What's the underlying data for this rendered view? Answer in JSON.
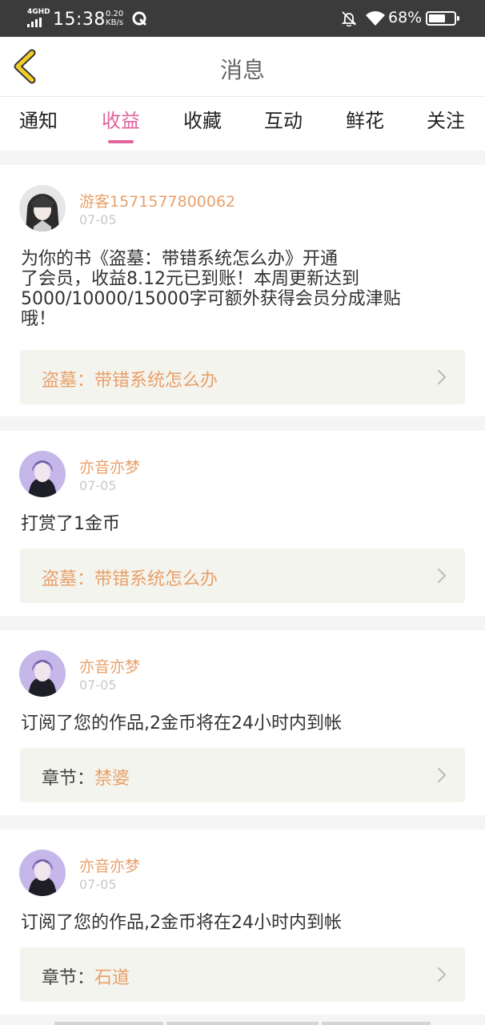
{
  "status_bar": {
    "network": "4GHD",
    "time": "15:38",
    "speed_value": "0.20",
    "speed_unit": "KB/s",
    "battery_percent": "68%",
    "battery_level": 0.68,
    "icons": [
      "signal-icon",
      "app-q-icon",
      "bell-off-icon",
      "wifi-icon",
      "battery-icon"
    ]
  },
  "header": {
    "title": "消息",
    "back_icon": "chevron-left-icon",
    "accent_color": "#e8c020"
  },
  "tabs": [
    {
      "label": "通知",
      "active": false
    },
    {
      "label": "收益",
      "active": true
    },
    {
      "label": "收藏",
      "active": false
    },
    {
      "label": "互动",
      "active": false
    },
    {
      "label": "鲜花",
      "active": false
    },
    {
      "label": "关注",
      "active": false
    }
  ],
  "colors": {
    "tab_active": "#e0659d",
    "username": "#e8a06a",
    "link_text": "#e8a06a",
    "link_bg": "#f4f4ee"
  },
  "messages": [
    {
      "username": "游客1571577800062",
      "date": "07-05",
      "text_lines": [
        "为你的书《盗墓：带错系统怎么办》开通",
        "了会员，收益8.12元已到账！本周更新达到",
        "5000/10000/15000字可额外获得会员分成津贴",
        "哦！"
      ],
      "link_label": "",
      "link_text": "盗墓：带错系统怎么办"
    },
    {
      "username": "亦音亦梦",
      "date": "07-05",
      "text_lines": [
        "打赏了1金币"
      ],
      "link_label": "",
      "link_text": "盗墓：带错系统怎么办"
    },
    {
      "username": "亦音亦梦",
      "date": "07-05",
      "text_lines": [
        "订阅了您的作品,2金币将在24小时内到帐"
      ],
      "link_label": "章节：",
      "link_text": "禁婆"
    },
    {
      "username": "亦音亦梦",
      "date": "07-05",
      "text_lines": [
        "订阅了您的作品,2金币将在24小时内到帐"
      ],
      "link_label": "章节：",
      "link_text": "石道"
    }
  ]
}
